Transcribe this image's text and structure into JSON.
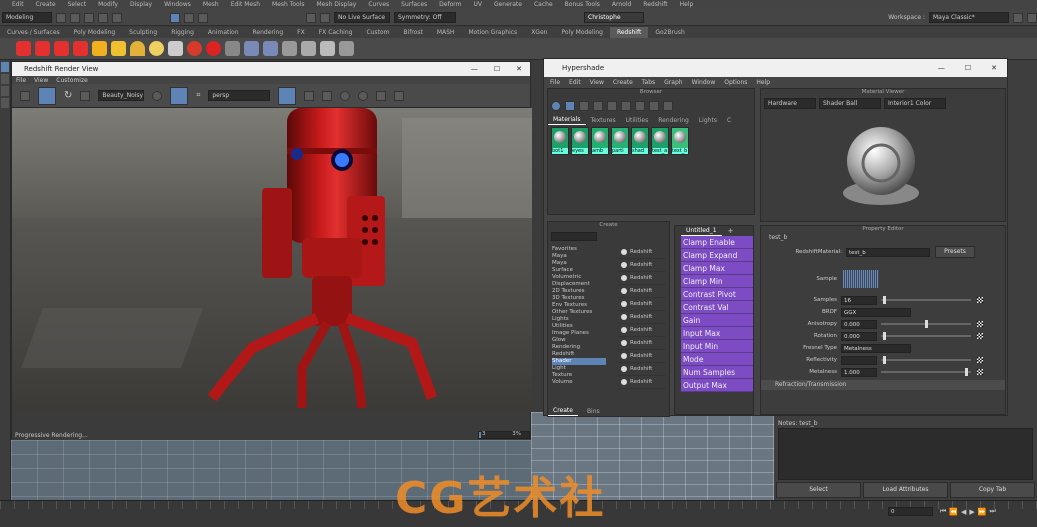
{
  "menubar": {
    "items": [
      "Edit",
      "Create",
      "Select",
      "Modify",
      "Display",
      "Windows",
      "Mesh",
      "Edit Mesh",
      "Mesh Tools",
      "Mesh Display",
      "Curves",
      "Surfaces",
      "Deform",
      "UV",
      "Generate",
      "Cache",
      "Bonus Tools",
      "Arnold",
      "Redshift",
      "Help"
    ]
  },
  "statusline": {
    "mode": "Modeling",
    "live_surface": "No Live Surface",
    "symmetry": "Symmetry: Off",
    "user": "Christophe",
    "workspace_label": "Workspace :",
    "workspace": "Maya Classic*"
  },
  "shelf": {
    "tabs": [
      "Curves / Surfaces",
      "Poly Modeling",
      "Sculpting",
      "Rigging",
      "Animation",
      "Rendering",
      "FX",
      "FX Caching",
      "Custom",
      "Bifrost",
      "MASH",
      "Motion Graphics",
      "XGen",
      "Poly Modeling",
      "Redshift",
      "Go2Brush"
    ],
    "active_tab": "Redshift"
  },
  "render_view": {
    "title": "Redshift Render View",
    "menu": [
      "File",
      "View",
      "Customize"
    ],
    "aov": "Beauty_Noisy",
    "camera": "persp",
    "status": "Progressive Rendering...",
    "progress_value": "3",
    "progress_pct": "3%",
    "progress_fraction": 0.03
  },
  "hypershade": {
    "title": "Hypershade",
    "menu": [
      "File",
      "Edit",
      "View",
      "Create",
      "Tabs",
      "Graph",
      "Window",
      "Options",
      "Help"
    ],
    "browser": {
      "title": "Browser",
      "tabs": [
        "Materials",
        "Textures",
        "Utilities",
        "Rendering",
        "Lights",
        "C"
      ],
      "active_tab": "Materials",
      "swatches": [
        "bot1",
        "eyes",
        "amb",
        "parti",
        "shad",
        "test_a",
        "test_b"
      ]
    },
    "create": {
      "title": "Create",
      "tree": [
        "Favorites",
        "Maya",
        "Maya",
        "Surface",
        "Volumetric",
        "Displacement",
        "2D Textures",
        "3D Textures",
        "Env Textures",
        "Other Textures",
        "Lights",
        "Utilities",
        "Image Planes",
        "Glow",
        "Rendering",
        "Redshift",
        "Shader",
        "Light",
        "Texture",
        "Volume"
      ],
      "items": [
        "Redshift",
        "Redshift",
        "Redshift",
        "Redshift",
        "Redshift",
        "Redshift",
        "Redshift",
        "Redshift",
        "Redshift",
        "Redshift",
        "Redshift"
      ],
      "bottom_tabs": [
        "Create",
        "Bins"
      ]
    },
    "graph": {
      "tab": "Untitled_1",
      "add": "+",
      "nodes": [
        "Clamp Enable",
        "Clamp Expand",
        "Clamp Max",
        "Clamp Min",
        "Contrast Pivot",
        "Contrast Val",
        "Gain",
        "Input Max",
        "Input Min",
        "Mode",
        "Num Samples",
        "Output Max"
      ]
    },
    "material_viewer": {
      "title": "Material Viewer",
      "renderer": "Hardware",
      "shape": "Shader Ball",
      "env": "Interior1 Color"
    },
    "property_editor": {
      "title": "Property Editor",
      "node": "test_b",
      "type_label": "RedshiftMaterial:",
      "name_value": "test_b",
      "presets": "Presets",
      "sample_label": "Sample",
      "rows": [
        {
          "label": "Samples",
          "value": "16"
        },
        {
          "label": "BRDF",
          "value": "GGX"
        },
        {
          "label": "Anisotropy",
          "value": "0.000"
        },
        {
          "label": "Rotation",
          "value": "0.000"
        },
        {
          "label": "Fresnel Type",
          "value": "Metalness"
        },
        {
          "label": "Reflectivity",
          "value": ""
        },
        {
          "label": "Metalness",
          "value": "1.000"
        }
      ],
      "section": "Refraction/Transmission"
    }
  },
  "channel_box": {
    "notes": "Notes:  test_b",
    "buttons": [
      "Select",
      "Load Attributes",
      "Copy Tab"
    ]
  },
  "timeline": {
    "current_frame": "0"
  },
  "watermark": "CG艺术社"
}
